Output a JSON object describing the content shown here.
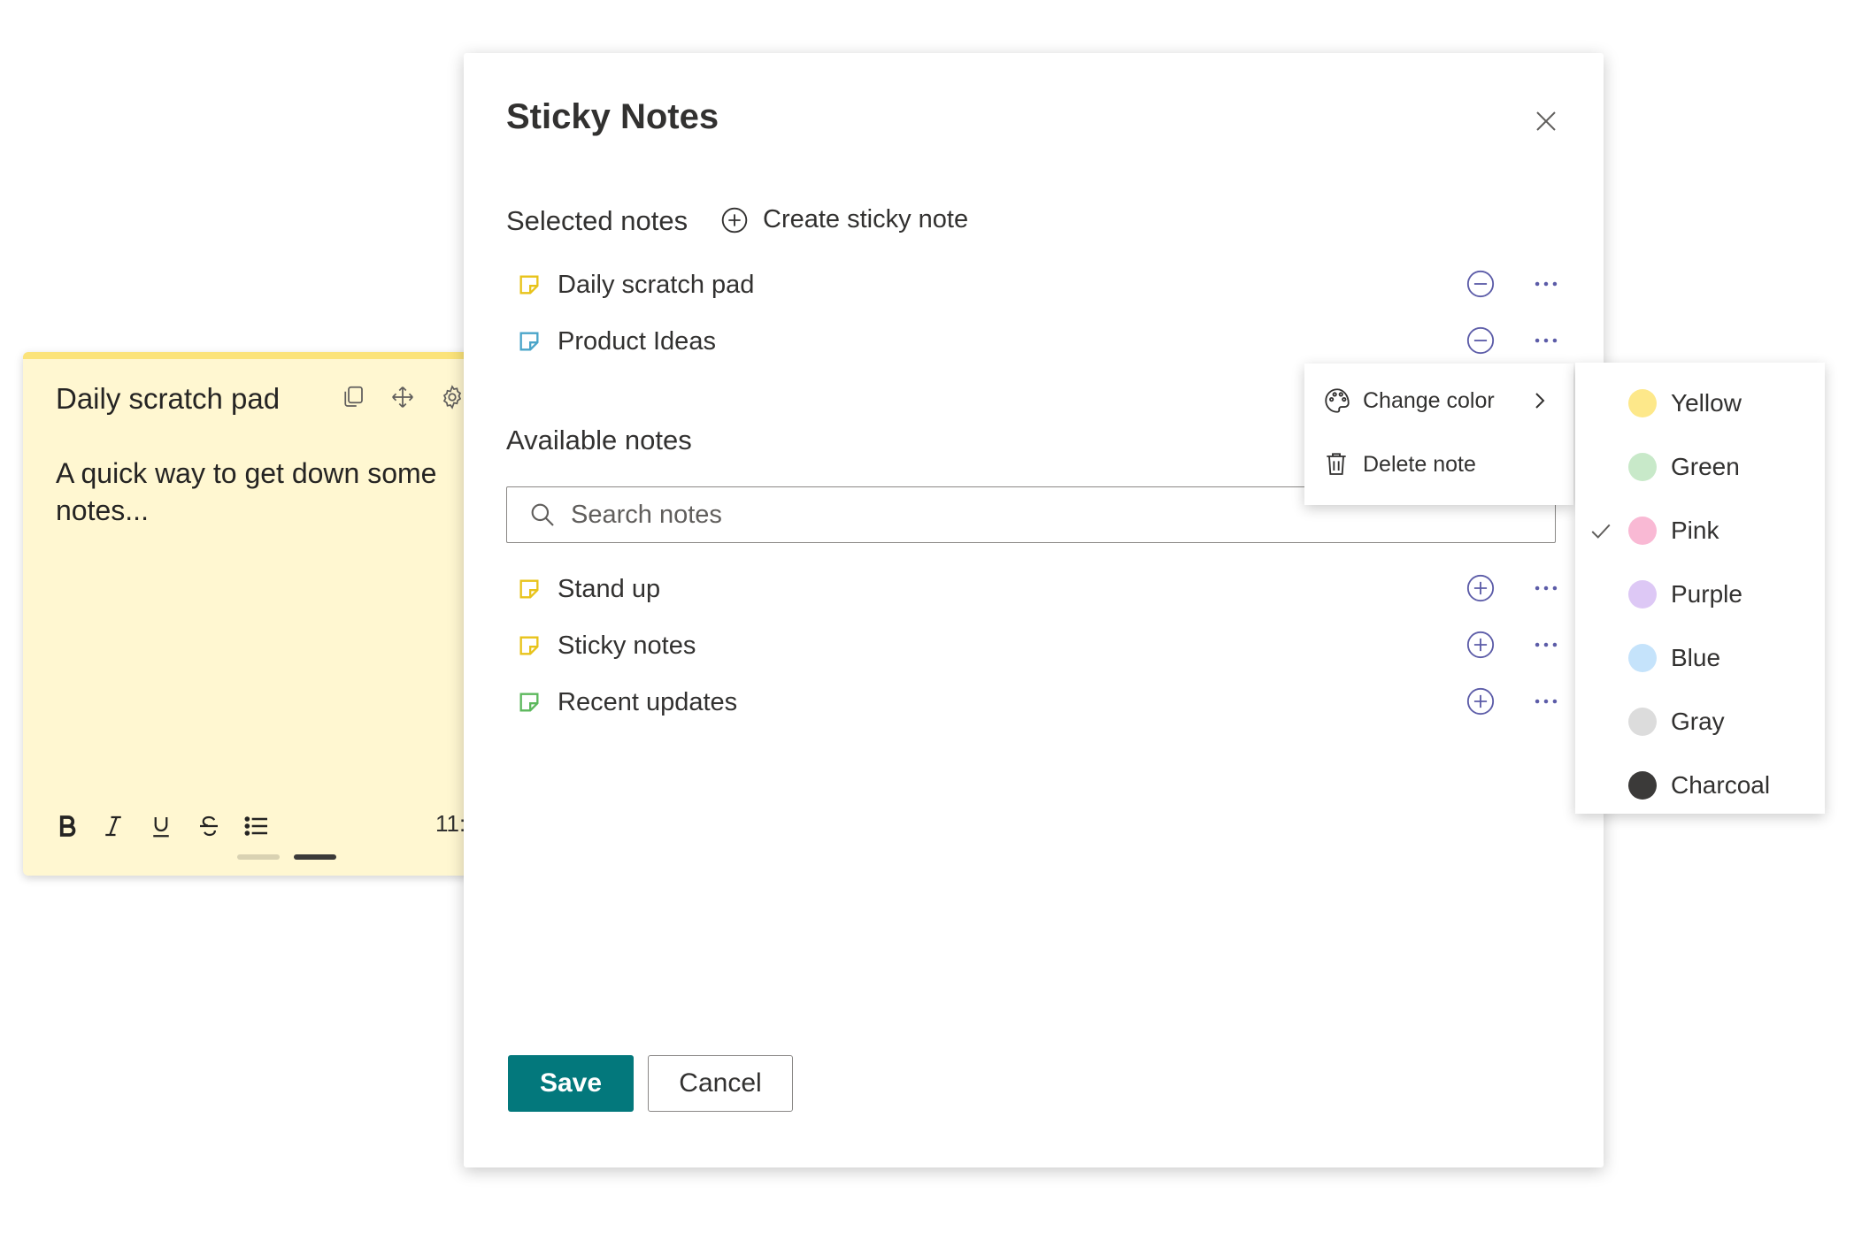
{
  "sticky_card": {
    "title": "Daily scratch pad",
    "body": "A quick way to get down some notes...",
    "time": "11:",
    "toolbar": [
      "bold",
      "italic",
      "underline",
      "strikethrough",
      "bullet-list"
    ],
    "bg_color": "#fff7d1"
  },
  "dialog": {
    "title": "Sticky Notes",
    "selected_label": "Selected notes",
    "create_label": "Create sticky note",
    "available_label": "Available notes",
    "search_placeholder": "Search notes",
    "save_label": "Save",
    "cancel_label": "Cancel",
    "accent": "#03787c"
  },
  "selected_notes": [
    {
      "label": "Daily scratch pad",
      "color": "#e8c31a"
    },
    {
      "label": "Product Ideas",
      "color": "#4aa5c9"
    }
  ],
  "available_notes": [
    {
      "label": "Stand up",
      "color": "#e8c31a"
    },
    {
      "label": "Sticky notes",
      "color": "#e8c31a"
    },
    {
      "label": "Recent updates",
      "color": "#5cb85c"
    }
  ],
  "context_menu": {
    "change_color": "Change color",
    "delete_note": "Delete note"
  },
  "color_menu": {
    "selected": "Pink",
    "options": [
      {
        "label": "Yellow",
        "color": "#fde88a"
      },
      {
        "label": "Green",
        "color": "#c8e9c9"
      },
      {
        "label": "Pink",
        "color": "#f9b9d4"
      },
      {
        "label": "Purple",
        "color": "#ddc8f5"
      },
      {
        "label": "Blue",
        "color": "#c5e3fb"
      },
      {
        "label": "Gray",
        "color": "#dcdcdc"
      },
      {
        "label": "Charcoal",
        "color": "#3b3a39"
      }
    ]
  }
}
